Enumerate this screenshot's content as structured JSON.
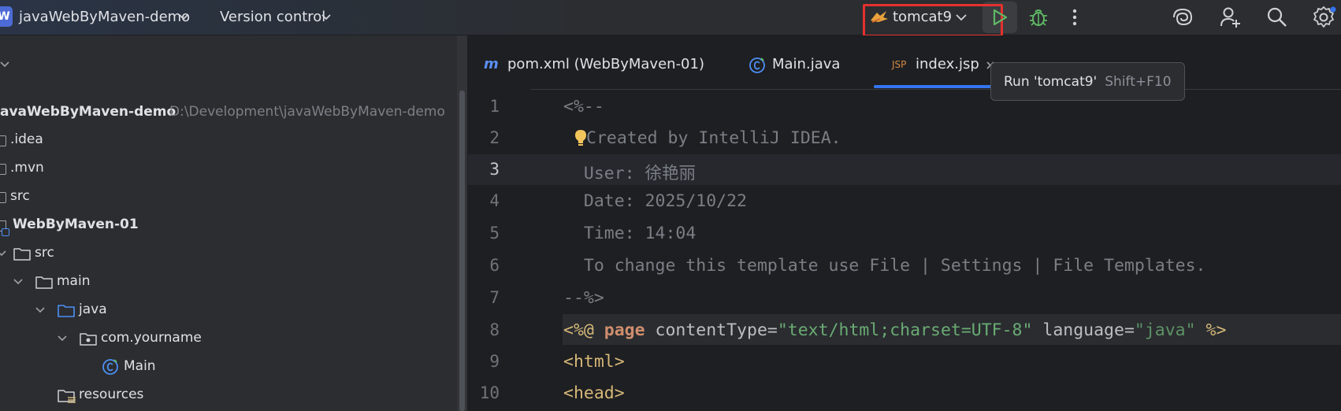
{
  "titlebar": {
    "project_badge": "W",
    "project_name": "javaWebByMaven-demo",
    "vcs_label": "Version control",
    "run_config": "tomcat9",
    "icons": [
      "chevron-down-icon",
      "tomcat-icon",
      "run-icon",
      "debug-icon",
      "more-icon",
      "ai-assistant-icon",
      "add-user-icon",
      "search-icon",
      "settings-icon"
    ]
  },
  "tree": {
    "items": [
      {
        "label": "avaWebByMaven-demo",
        "path": "D:\\Development\\javaWebByMaven-demo",
        "bold": true
      },
      {
        "label": ".idea"
      },
      {
        "label": ".mvn"
      },
      {
        "label": "src"
      },
      {
        "label": "WebByMaven-01",
        "bold": true
      },
      {
        "label": "src"
      },
      {
        "label": "main"
      },
      {
        "label": "java"
      },
      {
        "label": "com.yourname"
      },
      {
        "label": "Main"
      },
      {
        "label": "resources"
      }
    ]
  },
  "editor": {
    "tabs": [
      {
        "icon": "m",
        "label": "pom.xml (WebByMaven-01)"
      },
      {
        "label": "Main.java"
      },
      {
        "icon": "JSP",
        "label": "index.jsp",
        "active": true
      }
    ],
    "line_numbers": [
      "1",
      "2",
      "3",
      "4",
      "5",
      "6",
      "7",
      "8",
      "9",
      "10"
    ],
    "current_line": "3",
    "code": {
      "l1": "<%--",
      "l2": "Created by IntelliJ IDEA.",
      "l3": "  User: 徐艳丽",
      "l4": "  Date: 2025/10/22",
      "l5": "  Time: 14:04",
      "l6": "  To change this template use File | Settings | File Templates.",
      "l7": "--%>",
      "l8": {
        "open": "<%@ ",
        "kw": "page",
        "attr1": " contentType=",
        "val1": "\"text/html;charset=UTF-8\"",
        "attr2": " language=",
        "val2": "\"java\"",
        "close": " %>"
      },
      "l9": "<html>",
      "l10": "<head>"
    }
  },
  "tooltip": {
    "label": "Run 'tomcat9'",
    "shortcut": "Shift+F10"
  },
  "colors": {
    "accent": "#3574f0",
    "run_highlight": "#e5312e",
    "run_green": "#5fb865"
  }
}
